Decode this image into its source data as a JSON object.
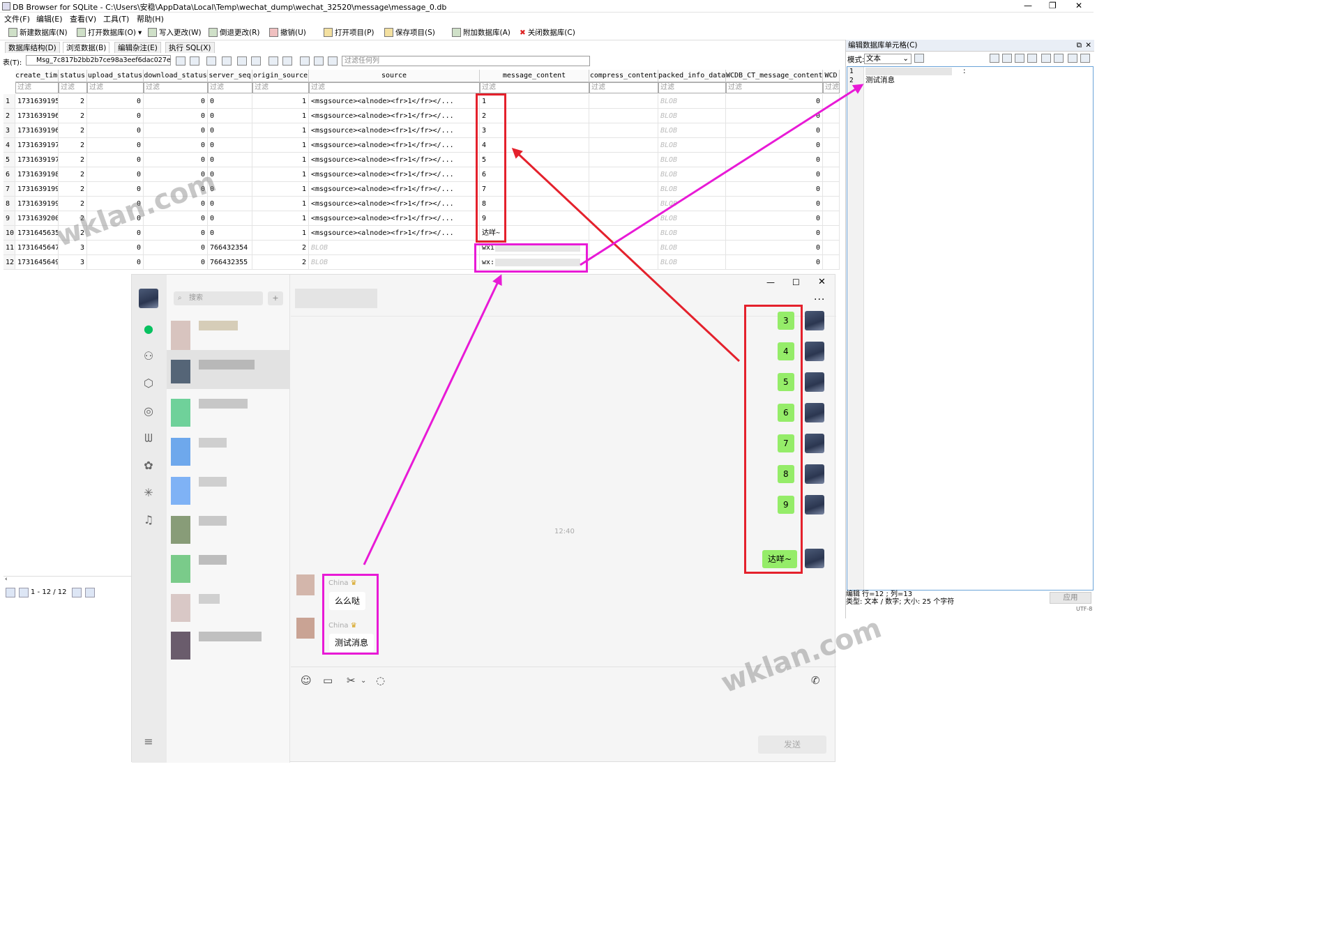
{
  "window": {
    "title": "DB Browser for SQLite - C:\\Users\\安稳\\AppData\\Local\\Temp\\wechat_dump\\wechat_32520\\message\\message_0.db"
  },
  "menu": [
    "文件(F)",
    "编辑(E)",
    "查看(V)",
    "工具(T)",
    "帮助(H)"
  ],
  "toolbar": {
    "new_db": "新建数据库(N)",
    "open_db": "打开数据库(O)",
    "write": "写入更改(W)",
    "revert": "倒退更改(R)",
    "undo": "撤销(U)",
    "open_project": "打开项目(P)",
    "save_project": "保存项目(S)",
    "attach": "附加数据库(A)",
    "close_db": "关闭数据库(C)"
  },
  "tabs": [
    "数据库结构(D)",
    "浏览数据(B)",
    "编辑杂注(E)",
    "执行 SQL(X)"
  ],
  "browse": {
    "table_label": "表(T):",
    "table_name": "Msg_7c817b2bb2b7ce98a3eef6dac027e88d",
    "filter_placeholder": "过滤任何列"
  },
  "grid": {
    "columns": [
      "create_time",
      "status",
      "upload_status",
      "download_status",
      "server_seq",
      "origin_source",
      "source",
      "message_content",
      "compress_content",
      "packed_info_data",
      "WCDB_CT_message_content",
      "WCD"
    ],
    "filter_text": "过滤",
    "rows": [
      {
        "n": "1",
        "create_time": "1731639195",
        "status": "2",
        "upload_status": "0",
        "download_status": "0",
        "server_seq": "0",
        "origin_source": "1",
        "source": "<msgsource><alnode><fr>1</fr></...",
        "message_content": "1",
        "compress_content": "",
        "packed_info_data": "BLOB",
        "wcdb": "0"
      },
      {
        "n": "2",
        "create_time": "1731639196",
        "status": "2",
        "upload_status": "0",
        "download_status": "0",
        "server_seq": "0",
        "origin_source": "1",
        "source": "<msgsource><alnode><fr>1</fr></...",
        "message_content": "2",
        "compress_content": "",
        "packed_info_data": "BLOB",
        "wcdb": "0"
      },
      {
        "n": "3",
        "create_time": "1731639196",
        "status": "2",
        "upload_status": "0",
        "download_status": "0",
        "server_seq": "0",
        "origin_source": "1",
        "source": "<msgsource><alnode><fr>1</fr></...",
        "message_content": "3",
        "compress_content": "",
        "packed_info_data": "BLOB",
        "wcdb": "0"
      },
      {
        "n": "4",
        "create_time": "1731639197",
        "status": "2",
        "upload_status": "0",
        "download_status": "0",
        "server_seq": "0",
        "origin_source": "1",
        "source": "<msgsource><alnode><fr>1</fr></...",
        "message_content": "4",
        "compress_content": "",
        "packed_info_data": "BLOB",
        "wcdb": "0"
      },
      {
        "n": "5",
        "create_time": "1731639197",
        "status": "2",
        "upload_status": "0",
        "download_status": "0",
        "server_seq": "0",
        "origin_source": "1",
        "source": "<msgsource><alnode><fr>1</fr></...",
        "message_content": "5",
        "compress_content": "",
        "packed_info_data": "BLOB",
        "wcdb": "0"
      },
      {
        "n": "6",
        "create_time": "1731639198",
        "status": "2",
        "upload_status": "0",
        "download_status": "0",
        "server_seq": "0",
        "origin_source": "1",
        "source": "<msgsource><alnode><fr>1</fr></...",
        "message_content": "6",
        "compress_content": "",
        "packed_info_data": "BLOB",
        "wcdb": "0"
      },
      {
        "n": "7",
        "create_time": "1731639199",
        "status": "2",
        "upload_status": "0",
        "download_status": "0",
        "server_seq": "0",
        "origin_source": "1",
        "source": "<msgsource><alnode><fr>1</fr></...",
        "message_content": "7",
        "compress_content": "",
        "packed_info_data": "BLOB",
        "wcdb": "0"
      },
      {
        "n": "8",
        "create_time": "1731639199",
        "status": "2",
        "upload_status": "0",
        "download_status": "0",
        "server_seq": "0",
        "origin_source": "1",
        "source": "<msgsource><alnode><fr>1</fr></...",
        "message_content": "8",
        "compress_content": "",
        "packed_info_data": "BLOB",
        "wcdb": "0"
      },
      {
        "n": "9",
        "create_time": "1731639200",
        "status": "2",
        "upload_status": "0",
        "download_status": "0",
        "server_seq": "0",
        "origin_source": "1",
        "source": "<msgsource><alnode><fr>1</fr></...",
        "message_content": "9",
        "compress_content": "",
        "packed_info_data": "BLOB",
        "wcdb": "0"
      },
      {
        "n": "10",
        "create_time": "1731645635",
        "status": "2",
        "upload_status": "0",
        "download_status": "0",
        "server_seq": "0",
        "origin_source": "1",
        "source": "<msgsource><alnode><fr>1</fr></...",
        "message_content": "达咩~",
        "compress_content": "",
        "packed_info_data": "BLOB",
        "wcdb": "0"
      },
      {
        "n": "11",
        "create_time": "1731645647",
        "status": "3",
        "upload_status": "0",
        "download_status": "0",
        "server_seq": "766432354",
        "origin_source": "2",
        "source": "BLOB",
        "message_content": "wxi",
        "compress_content": "",
        "packed_info_data": "BLOB",
        "wcdb": "0"
      },
      {
        "n": "12",
        "create_time": "1731645649",
        "status": "3",
        "upload_status": "0",
        "download_status": "0",
        "server_seq": "766432355",
        "origin_source": "2",
        "source": "BLOB",
        "message_content": "wx:",
        "compress_content": "",
        "packed_info_data": "BLOB",
        "wcdb": "0"
      }
    ]
  },
  "nav": {
    "range": "1 - 12 / 12"
  },
  "edit_cell": {
    "title": "编辑数据库单元格(C)",
    "mode_label": "模式:",
    "mode_value": "文本",
    "lines": [
      "1",
      "2"
    ],
    "line1_text": ":",
    "line2_text": "测试消息",
    "status1": "编辑 行=12 ; 列=13",
    "status2": "类型: 文本 / 数字; 大小: 25 个字符",
    "apply": "应用",
    "encoding": "UTF-8"
  },
  "wechat": {
    "search_placeholder": "搜索",
    "time": "12:40",
    "sent": [
      "3",
      "4",
      "5",
      "6",
      "7",
      "8",
      "9",
      "达咩~"
    ],
    "incoming": [
      {
        "sender": "China",
        "text": "么么哒"
      },
      {
        "sender": "China",
        "text": "测试消息"
      }
    ],
    "send": "发送"
  },
  "watermark": "wklan.com",
  "colors": {
    "red_box": "#e4212c",
    "magenta_box": "#e81ad6",
    "bubble_green": "#95ec69"
  }
}
